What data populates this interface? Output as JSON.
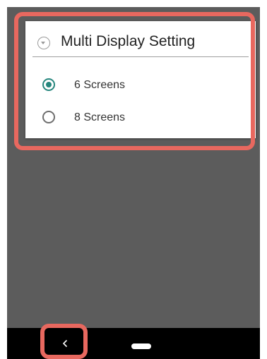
{
  "dialog": {
    "title": "Multi Display Setting",
    "header_icon": "chevron-down-circle-icon",
    "options": [
      {
        "label": "6 Screens",
        "selected": true
      },
      {
        "label": "8 Screens",
        "selected": false
      }
    ]
  },
  "navbar": {
    "back_icon": "back-chevron-icon",
    "home_icon": "home-pill-icon"
  },
  "colors": {
    "accent": "#26867d",
    "highlight": "#e8685f",
    "backdrop": "#5c5c5c",
    "navbar": "#000000"
  }
}
